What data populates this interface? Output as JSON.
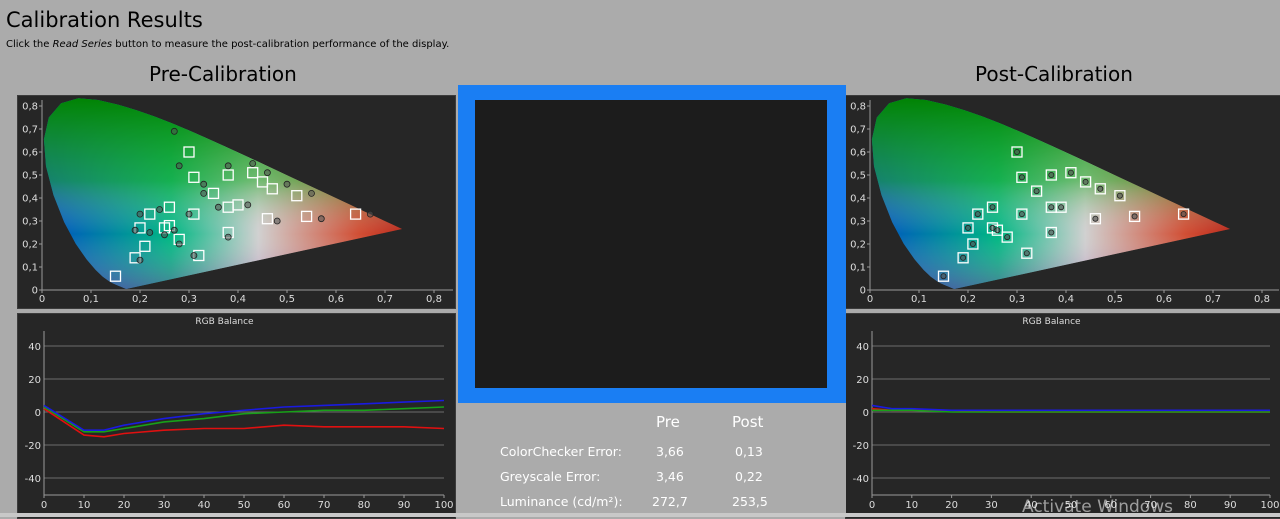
{
  "header": {
    "title": "Calibration Results",
    "subtitle_pre": "Click the ",
    "subtitle_em": "Read Series",
    "subtitle_post": " button to measure the post-calibration performance of the display."
  },
  "pre": {
    "title": "Pre-Calibration",
    "gamut_ticks_x": [
      "0",
      "0,1",
      "0,2",
      "0,3",
      "0,4",
      "0,5",
      "0,6",
      "0,7",
      "0,8"
    ],
    "gamut_ticks_y": [
      "0,8",
      "0,7",
      "0,6",
      "0,5",
      "0,4",
      "0,3",
      "0,2",
      "0,1",
      "0"
    ],
    "rgb_title": "RGB Balance",
    "rgb_ticks_x": [
      "0",
      "10",
      "20",
      "30",
      "40",
      "50",
      "60",
      "70",
      "80",
      "90",
      "100"
    ],
    "rgb_ticks_y": [
      "40",
      "20",
      "0",
      "-20",
      "-40"
    ]
  },
  "post": {
    "title": "Post-Calibration",
    "gamut_ticks_x": [
      "0",
      "0,1",
      "0,2",
      "0,3",
      "0,4",
      "0,5",
      "0,6",
      "0,7",
      "0,8"
    ],
    "gamut_ticks_y": [
      "0,8",
      "0,7",
      "0,6",
      "0,5",
      "0,4",
      "0,3",
      "0,2",
      "0,1",
      "0"
    ],
    "rgb_title": "RGB Balance",
    "rgb_ticks_x": [
      "0",
      "10",
      "20",
      "30",
      "40",
      "50",
      "60",
      "70",
      "80",
      "90",
      "100"
    ],
    "rgb_ticks_y": [
      "40",
      "20",
      "0",
      "-20",
      "-40"
    ]
  },
  "stats": {
    "col_pre": "Pre",
    "col_post": "Post",
    "rows": [
      {
        "label": "ColorChecker Error:",
        "pre": "3,66",
        "post": "0,13"
      },
      {
        "label": "Greyscale Error:",
        "pre": "3,46",
        "post": "0,22"
      },
      {
        "label": "Luminance (cd/m²):",
        "pre": "272,7",
        "post": "253,5"
      }
    ]
  },
  "colors": {
    "center_frame": "#1a7ef3",
    "red": "#e01010",
    "green": "#18a018",
    "blue": "#1a1ae0"
  },
  "watermark": "Activate Windows",
  "chart_data": [
    {
      "type": "scatter",
      "title": "Pre-Calibration",
      "xlim": [
        0,
        0.8
      ],
      "ylim": [
        0,
        0.8
      ],
      "series": [
        {
          "values": [
            [
              0.15,
              0.06
            ],
            [
              0.19,
              0.14
            ],
            [
              0.21,
              0.19
            ],
            [
              0.2,
              0.27
            ],
            [
              0.22,
              0.33
            ],
            [
              0.26,
              0.36
            ],
            [
              0.3,
              0.6
            ],
            [
              0.31,
              0.49
            ],
            [
              0.31,
              0.33
            ],
            [
              0.25,
              0.27
            ],
            [
              0.28,
              0.22
            ],
            [
              0.32,
              0.15
            ],
            [
              0.38,
              0.25
            ],
            [
              0.38,
              0.36
            ],
            [
              0.46,
              0.31
            ],
            [
              0.54,
              0.32
            ],
            [
              0.64,
              0.33
            ],
            [
              0.52,
              0.41
            ],
            [
              0.47,
              0.44
            ],
            [
              0.45,
              0.47
            ],
            [
              0.43,
              0.51
            ],
            [
              0.38,
              0.5
            ],
            [
              0.4,
              0.37
            ],
            [
              0.35,
              0.42
            ],
            [
              0.26,
              0.28
            ]
          ]
        },
        {
          "values": [
            [
              0.27,
              0.69
            ],
            [
              0.28,
              0.54
            ],
            [
              0.38,
              0.54
            ],
            [
              0.43,
              0.55
            ],
            [
              0.46,
              0.51
            ],
            [
              0.5,
              0.46
            ],
            [
              0.55,
              0.42
            ],
            [
              0.67,
              0.33
            ],
            [
              0.57,
              0.31
            ],
            [
              0.48,
              0.3
            ],
            [
              0.42,
              0.37
            ],
            [
              0.38,
              0.23
            ],
            [
              0.33,
              0.46
            ],
            [
              0.3,
              0.33
            ],
            [
              0.24,
              0.35
            ],
            [
              0.2,
              0.33
            ],
            [
              0.19,
              0.26
            ],
            [
              0.22,
              0.25
            ],
            [
              0.25,
              0.24
            ],
            [
              0.28,
              0.2
            ],
            [
              0.31,
              0.15
            ],
            [
              0.2,
              0.13
            ],
            [
              0.36,
              0.36
            ],
            [
              0.33,
              0.42
            ],
            [
              0.27,
              0.26
            ]
          ]
        }
      ]
    },
    {
      "type": "line",
      "title": "RGB Balance",
      "x": [
        0,
        10,
        15,
        20,
        30,
        40,
        50,
        60,
        70,
        80,
        90,
        100
      ],
      "ylim": [
        -50,
        50
      ],
      "series": [
        {
          "name": "R",
          "values": [
            2,
            -14,
            -15,
            -13,
            -11,
            -10,
            -10,
            -8,
            -9,
            -9,
            -9,
            -10
          ]
        },
        {
          "name": "G",
          "values": [
            3,
            -12,
            -12,
            -10,
            -6,
            -4,
            -1,
            0,
            1,
            1,
            2,
            3
          ]
        },
        {
          "name": "B",
          "values": [
            4,
            -11,
            -11,
            -8,
            -4,
            -1,
            1,
            3,
            4,
            5,
            6,
            7
          ]
        }
      ]
    },
    {
      "type": "scatter",
      "title": "Post-Calibration",
      "xlim": [
        0,
        0.8
      ],
      "ylim": [
        0,
        0.8
      ],
      "series": [
        {
          "values": [
            [
              0.15,
              0.06
            ],
            [
              0.19,
              0.14
            ],
            [
              0.21,
              0.2
            ],
            [
              0.2,
              0.27
            ],
            [
              0.22,
              0.33
            ],
            [
              0.25,
              0.27
            ],
            [
              0.28,
              0.23
            ],
            [
              0.3,
              0.6
            ],
            [
              0.31,
              0.49
            ],
            [
              0.31,
              0.33
            ],
            [
              0.32,
              0.16
            ],
            [
              0.37,
              0.25
            ],
            [
              0.37,
              0.36
            ],
            [
              0.46,
              0.31
            ],
            [
              0.54,
              0.32
            ],
            [
              0.64,
              0.33
            ],
            [
              0.51,
              0.41
            ],
            [
              0.47,
              0.44
            ],
            [
              0.44,
              0.47
            ],
            [
              0.41,
              0.51
            ],
            [
              0.37,
              0.5
            ],
            [
              0.39,
              0.36
            ],
            [
              0.34,
              0.43
            ],
            [
              0.26,
              0.26
            ],
            [
              0.25,
              0.36
            ]
          ]
        }
      ]
    },
    {
      "type": "line",
      "title": "RGB Balance",
      "x": [
        0,
        5,
        10,
        20,
        30,
        40,
        50,
        60,
        70,
        80,
        90,
        100
      ],
      "ylim": [
        -50,
        50
      ],
      "series": [
        {
          "name": "R",
          "values": [
            2,
            1,
            1,
            1,
            0,
            0,
            0,
            0,
            0,
            0,
            0,
            0
          ]
        },
        {
          "name": "G",
          "values": [
            1,
            1,
            1,
            0,
            0,
            0,
            0,
            0,
            0,
            0,
            0,
            0
          ]
        },
        {
          "name": "B",
          "values": [
            4,
            2,
            2,
            1,
            1,
            1,
            1,
            1,
            1,
            1,
            1,
            1
          ]
        }
      ]
    }
  ]
}
